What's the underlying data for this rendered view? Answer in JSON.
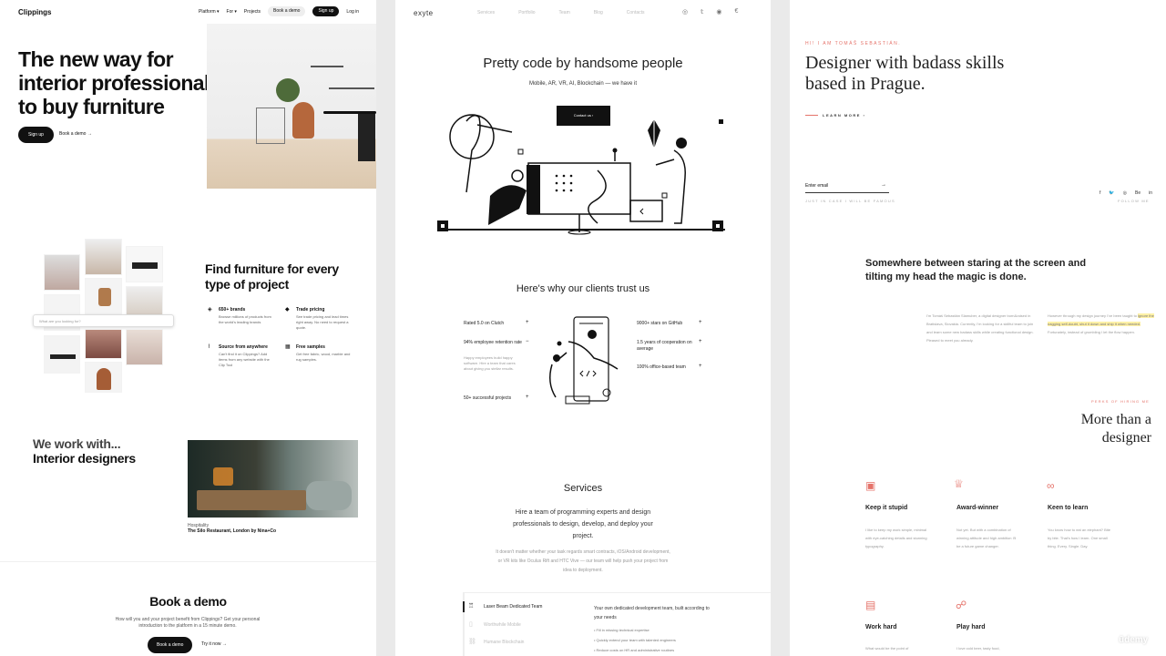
{
  "clippings": {
    "logo": "Clippings",
    "nav": {
      "platform": "Platform ▾",
      "for": "For ▾",
      "projects": "Projects",
      "book_demo": "Book a demo",
      "sign_up": "Sign up",
      "log_in": "Log in"
    },
    "hero_title": "The new way for interior professionals to buy furniture",
    "hero_signup": "Sign up",
    "hero_book_demo": "Book a demo →",
    "search_placeholder": "What are you looking for?",
    "find_title": "Find furniture for every type of project",
    "features": [
      {
        "icon": "layers-icon",
        "title": "650+ brands",
        "desc": "Browse millions of products from the world's leading brands"
      },
      {
        "icon": "tag-icon",
        "title": "Trade pricing",
        "desc": "See trade pricing and lead times right away. No need to request a quote."
      },
      {
        "icon": "paperclip-icon",
        "title": "Source from anywhere",
        "desc": "Can't find it on Clippings? Add items from any website with the Clip Tool"
      },
      {
        "icon": "grid-icon",
        "title": "Free samples",
        "desc": "Get free fabric, wood, marble and rug samples."
      }
    ],
    "work_with_1": "We work with...",
    "work_with_2": "Interior designers",
    "caption_category": "Hospitality",
    "caption_name": "The Silo Restaurant, London by Nina+Co",
    "book_title": "Book a demo",
    "book_desc": "How will you and your project benefit from Clippings? Get your personal introduction to the platform in a 15 minute demo.",
    "book_button": "Book a demo",
    "try_now": "Try it now →"
  },
  "exyte": {
    "logo": "exyte",
    "nav": [
      "Services",
      "Portfolio",
      "Team",
      "Blog",
      "Contacts"
    ],
    "social_icons": [
      "instagram-icon",
      "twitter-icon",
      "github-icon",
      "clutch-icon"
    ],
    "social_glyphs": [
      "◎",
      "𝕥",
      "◉",
      "€"
    ],
    "hero_title": "Pretty code by handsome people",
    "hero_subtitle": "Mobile, AR, VR, AI, Blockchain — we have it",
    "contact_button": "Contact us  ›",
    "trust_title": "Here's why our clients trust us",
    "stats_left": [
      "Rated 5.0 on Clutch",
      "94% employee retention rate",
      "50+ successful projects"
    ],
    "stats_left_desc": "Happy employees build happy software. Hire a team that cares about giving you stellar results.",
    "stats_right": [
      "9000+ stars on GitHub",
      "1.5 years of cooperation on average",
      "100% office-based team"
    ],
    "services_title": "Services",
    "services_desc": "Hire a team of programming experts and design professionals to design, develop, and deploy your project.",
    "services_desc2": "It doesn't matter whether your task regards smart contracts, iOS/Android development, or VR kits like Oculus Rift and HTC Vive — our team will help push your project from idea to deployment.",
    "service_tabs": [
      "Laser Beam Dedicated Team",
      "Worthwhile Mobile",
      "Humane Blockchain"
    ],
    "team_desc": "Your own dedicated development team, built according to your needs",
    "team_bullets": [
      "Fill in missing technical expertise",
      "Quickly extend your team with talented engineers",
      "Reduce costs on HR and administrative routines"
    ]
  },
  "tomas": {
    "eyebrow": "HI! I AM TOMÁŠ SEBASTIÁN.",
    "title": "Designer with badass skills based in Prague.",
    "learn_more": "LEARN MORE  ›",
    "email_placeholder": "Enter email",
    "famous": "JUST IN CASE I WILL BE FAMOUS",
    "social": [
      "f",
      "🐦",
      "◎",
      "Be",
      "in"
    ],
    "follow": "FOLLOW ME",
    "quote": "Somewhere between staring at the screen and tilting my head the magic is done.",
    "bio_left": "I'm Tomáš Sebastián Slamuber, a digital designer born&raised in Bratislava, Slovakia. Currently, I'm looking for a skillful team to join and learn some new badass skills while creating functional design. Pleased to meet you already.",
    "bio_right_1": "However through my design journey I've been taught to ",
    "bio_right_hl": "ignore the nagging self-doubt, shut it down and ship it when needed.",
    "bio_right_2": " Fortunately, instead of grumbling I let the flow happen.",
    "perks_eyebrow": "PERKS OF HIRING ME",
    "perks_title": "More than a designer",
    "perks": [
      {
        "icon": "image-icon",
        "glyph": "▣",
        "title": "Keep it stupid",
        "desc": "I like to keep my work simple, minimal with eye-catching details and stunning typography."
      },
      {
        "icon": "trophy-icon",
        "glyph": "♕",
        "title": "Award-winner",
        "desc": "Not yet. But with a combination of winning attitude and high ambition I'll be a future game changer."
      },
      {
        "icon": "glasses-icon",
        "glyph": "∞",
        "title": "Keen to learn",
        "desc": "You know how to eat an elephant? Bite by bite. That's how I learn. One small thing. Every. Single. Day."
      },
      {
        "icon": "calculator-icon",
        "glyph": "▤",
        "title": "Work hard",
        "desc": "What would be the point of"
      },
      {
        "icon": "gamepad-icon",
        "glyph": "☍",
        "title": "Play hard",
        "desc": "I love cold beer, tasty food,"
      }
    ]
  },
  "watermark": "ūdemy"
}
